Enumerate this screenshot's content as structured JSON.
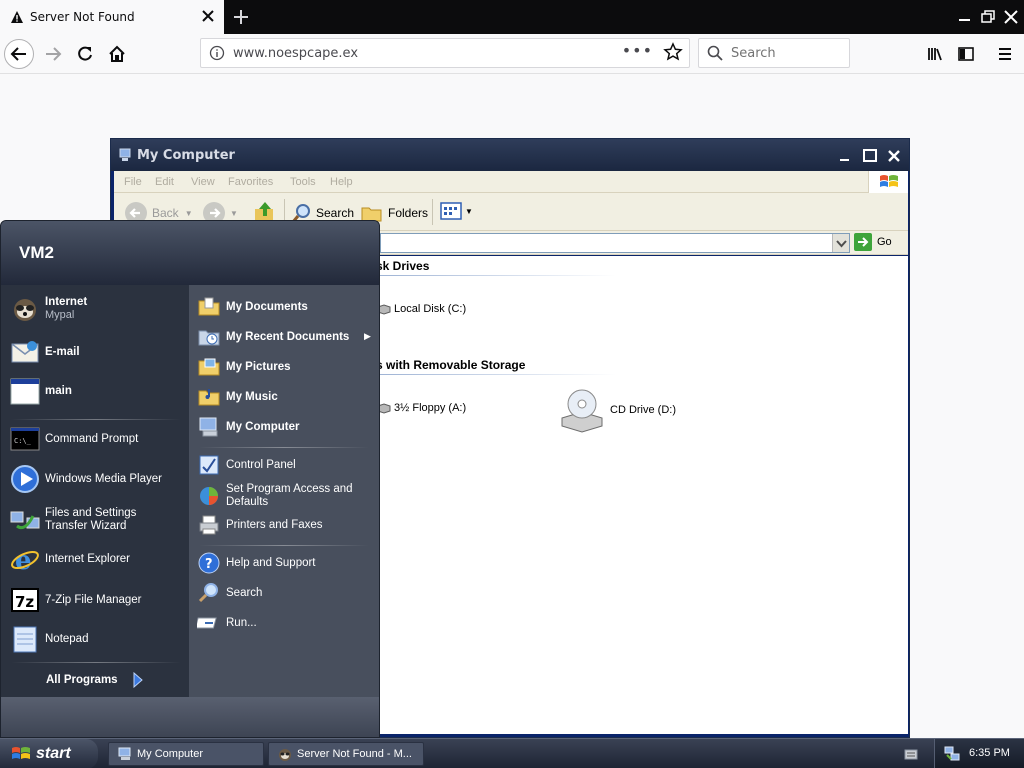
{
  "browser": {
    "tab_title": "Server Not Found",
    "url": "www.noespcape.ex",
    "url_menu": "•••",
    "search_placeholder": "Search"
  },
  "mycomputer": {
    "title": "My Computer",
    "menu": [
      "File",
      "Edit",
      "View",
      "Favorites",
      "Tools",
      "Help"
    ],
    "toolbar": {
      "back": "Back",
      "search": "Search",
      "folders": "Folders"
    },
    "address_go": "Go",
    "sections": [
      {
        "title": "sk Drives",
        "drives": [
          "Local Disk (C:)"
        ]
      },
      {
        "title": "s with Removable Storage",
        "drives": [
          "3½ Floppy (A:)",
          "CD Drive (D:)"
        ]
      }
    ]
  },
  "startmenu": {
    "user": "VM2",
    "pinned": [
      {
        "label": "Internet",
        "sub": "Mypal",
        "icon": "mypal-icon"
      },
      {
        "label": "E-mail",
        "icon": "email-icon"
      },
      {
        "label": "main",
        "icon": "window-icon"
      }
    ],
    "recent": [
      {
        "label": "Command Prompt",
        "icon": "cmd-icon"
      },
      {
        "label": "Windows Media Player",
        "icon": "media-player-icon"
      },
      {
        "label": "Files and Settings Transfer Wizard",
        "icon": "transfer-wizard-icon"
      },
      {
        "label": "Internet Explorer",
        "icon": "ie-icon"
      },
      {
        "label": "7-Zip File Manager",
        "icon": "7zip-icon"
      },
      {
        "label": "Notepad",
        "icon": "notepad-icon"
      }
    ],
    "all_programs": "All Programs",
    "places": [
      {
        "label": "My Documents"
      },
      {
        "label": "My Recent Documents"
      },
      {
        "label": "My Pictures"
      },
      {
        "label": "My Music"
      },
      {
        "label": "My Computer"
      }
    ],
    "settings": [
      {
        "label": "Control Panel"
      },
      {
        "label": "Set Program Access and Defaults"
      },
      {
        "label": "Printers and Faxes"
      }
    ],
    "help": [
      {
        "label": "Help and Support"
      },
      {
        "label": "Search"
      },
      {
        "label": "Run..."
      }
    ]
  },
  "taskbar": {
    "start": "start",
    "tasks": [
      "My Computer",
      "Server Not Found - M..."
    ],
    "clock": "6:35 PM"
  }
}
